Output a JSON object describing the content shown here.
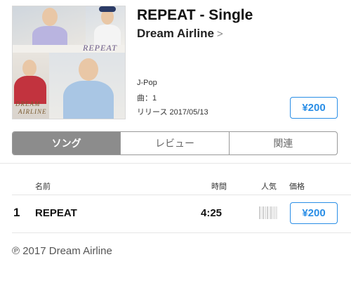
{
  "album": {
    "title": "REPEAT - Single",
    "artist": "Dream Airline",
    "artist_chevron": ">",
    "genre": "J-Pop",
    "track_count": "曲：1",
    "release": "リリース 2017/05/13",
    "price": "¥200",
    "artwork_text_top": "REPEAT",
    "artwork_text_bottom_1": "DREAM",
    "artwork_text_bottom_2": "AIRLINE"
  },
  "tabs": [
    {
      "label": "ソング",
      "active": true
    },
    {
      "label": "レビュー",
      "active": false
    },
    {
      "label": "関連",
      "active": false
    }
  ],
  "table": {
    "headers": {
      "name": "名前",
      "time": "時間",
      "popularity": "人気",
      "price": "価格"
    },
    "rows": [
      {
        "number": "1",
        "name": "REPEAT",
        "time": "4:25",
        "price": "¥200"
      }
    ]
  },
  "footer": {
    "copyright": "℗ 2017 Dream Airline"
  },
  "colors": {
    "accent": "#2a8ee6",
    "segment_active": "#8c8c8c"
  }
}
